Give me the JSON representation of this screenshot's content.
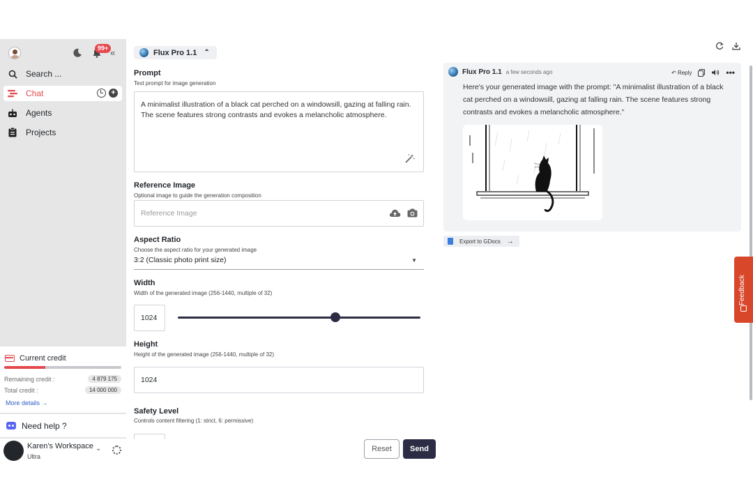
{
  "sidebar": {
    "notifications_badge": "99+",
    "nav": {
      "search": "Search ...",
      "chat": "Chat",
      "agents": "Agents",
      "projects": "Projects"
    },
    "credit": {
      "title": "Current credit",
      "remaining_label": "Remaining credit :",
      "remaining_value": "4 879 175",
      "total_label": "Total credit :",
      "total_value": "14 000 000",
      "used_fraction": 0.35,
      "more_details": "More details"
    },
    "help": "Need help ?",
    "workspace": {
      "name": "Karen's Workspace",
      "plan": "Ultra"
    }
  },
  "form": {
    "model": "Flux Pro 1.1",
    "prompt": {
      "label": "Prompt",
      "sub": "Text prompt for image generation",
      "value": "A minimalist illustration of a black cat perched on a windowsill, gazing at falling rain. The scene features strong contrasts and evokes a melancholic atmosphere."
    },
    "reference": {
      "label": "Reference Image",
      "sub": "Optional image to guide the generation composition",
      "placeholder": "Reference Image"
    },
    "aspect": {
      "label": "Aspect Ratio",
      "sub": "Choose the aspect ratio for your generated image",
      "value": "3:2 (Classic photo print size)"
    },
    "width": {
      "label": "Width",
      "sub": "Width of the generated image (256-1440, multiple of 32)",
      "value": "1024",
      "min": 256,
      "max": 1440
    },
    "height": {
      "label": "Height",
      "sub": "Height of the generated image (256-1440, multiple of 32)",
      "value": "1024"
    },
    "safety": {
      "label": "Safety Level",
      "sub": "Controls content filtering (1: strict, 6: permissive)"
    },
    "reset": "Reset",
    "send": "Send"
  },
  "chat": {
    "message": {
      "author": "Flux Pro 1.1",
      "time": "a few seconds ago",
      "reply": "Reply",
      "text": "Here's your generated image with the prompt: \"A minimalist illustration of a black cat perched on a windowsill, gazing at falling rain. The scene features strong contrasts and evokes a melancholic atmosphere.\""
    },
    "export": "Export to GDocs"
  },
  "feedback": "Feedback",
  "colors": {
    "accent": "#e5484d",
    "primary_button": "#2c2c44",
    "feedback": "#d9472b"
  }
}
